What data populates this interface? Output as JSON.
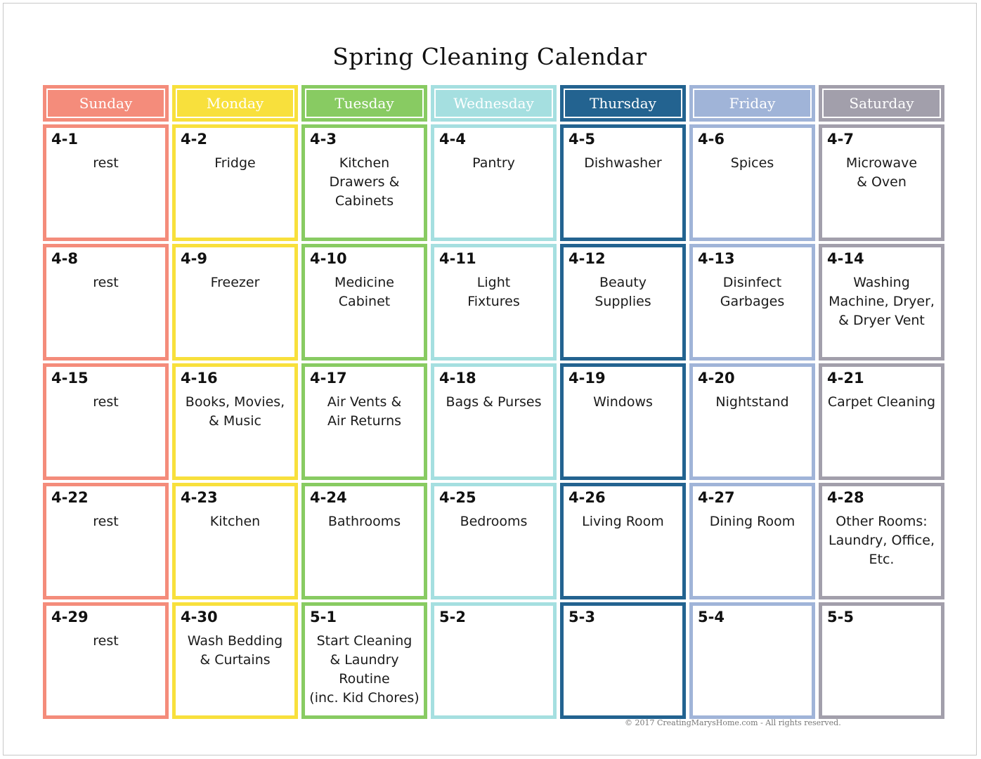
{
  "title": "Spring Cleaning Calendar",
  "footer": "© 2017 CreatingMarysHome.com - All rights reserved.",
  "days": [
    {
      "label": "Sunday",
      "color": "#f48c7b"
    },
    {
      "label": "Monday",
      "color": "#f8e03c"
    },
    {
      "label": "Tuesday",
      "color": "#88cb62"
    },
    {
      "label": "Wednesday",
      "color": "#a5dfe0"
    },
    {
      "label": "Thursday",
      "color": "#236390"
    },
    {
      "label": "Friday",
      "color": "#a0b4d8"
    },
    {
      "label": "Saturday",
      "color": "#a29fab"
    }
  ],
  "weeks": [
    [
      {
        "date": "4-1",
        "task": "rest"
      },
      {
        "date": "4-2",
        "task": "Fridge"
      },
      {
        "date": "4-3",
        "task": "Kitchen\nDrawers &\nCabinets"
      },
      {
        "date": "4-4",
        "task": "Pantry"
      },
      {
        "date": "4-5",
        "task": "Dishwasher"
      },
      {
        "date": "4-6",
        "task": "Spices"
      },
      {
        "date": "4-7",
        "task": "Microwave\n& Oven"
      }
    ],
    [
      {
        "date": "4-8",
        "task": "rest"
      },
      {
        "date": "4-9",
        "task": "Freezer"
      },
      {
        "date": "4-10",
        "task": "Medicine\nCabinet"
      },
      {
        "date": "4-11",
        "task": "Light\nFixtures"
      },
      {
        "date": "4-12",
        "task": "Beauty\nSupplies"
      },
      {
        "date": "4-13",
        "task": "Disinfect\nGarbages"
      },
      {
        "date": "4-14",
        "task": "Washing\nMachine, Dryer,\n& Dryer Vent"
      }
    ],
    [
      {
        "date": "4-15",
        "task": "rest"
      },
      {
        "date": "4-16",
        "task": "Books, Movies,\n& Music"
      },
      {
        "date": "4-17",
        "task": "Air Vents &\nAir Returns"
      },
      {
        "date": "4-18",
        "task": "Bags & Purses"
      },
      {
        "date": "4-19",
        "task": "Windows"
      },
      {
        "date": "4-20",
        "task": "Nightstand"
      },
      {
        "date": "4-21",
        "task": "Carpet Cleaning"
      }
    ],
    [
      {
        "date": "4-22",
        "task": "rest"
      },
      {
        "date": "4-23",
        "task": "Kitchen"
      },
      {
        "date": "4-24",
        "task": "Bathrooms"
      },
      {
        "date": "4-25",
        "task": "Bedrooms"
      },
      {
        "date": "4-26",
        "task": "Living Room"
      },
      {
        "date": "4-27",
        "task": "Dining Room"
      },
      {
        "date": "4-28",
        "task": "Other Rooms:\nLaundry, Office,\nEtc."
      }
    ],
    [
      {
        "date": "4-29",
        "task": "rest"
      },
      {
        "date": "4-30",
        "task": "Wash Bedding\n& Curtains"
      },
      {
        "date": "5-1",
        "task": "Start Cleaning\n& Laundry\nRoutine\n(inc. Kid Chores)"
      },
      {
        "date": "5-2",
        "task": ""
      },
      {
        "date": "5-3",
        "task": ""
      },
      {
        "date": "5-4",
        "task": ""
      },
      {
        "date": "5-5",
        "task": ""
      }
    ]
  ]
}
